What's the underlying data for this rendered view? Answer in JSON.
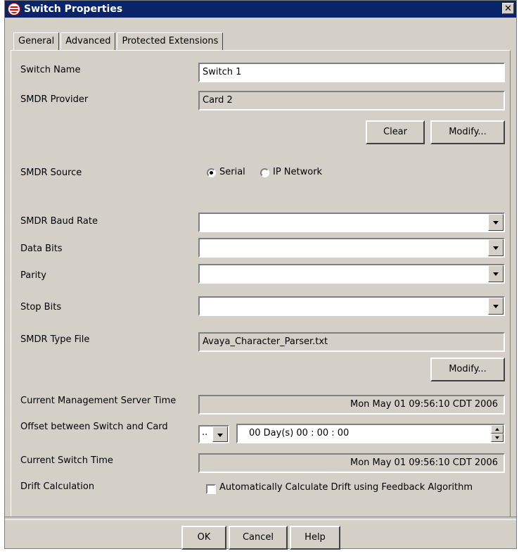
{
  "window": {
    "title": "Switch Properties",
    "close_glyph": "✕"
  },
  "tabs": [
    {
      "label": "General",
      "active": true
    },
    {
      "label": "Advanced",
      "active": false
    },
    {
      "label": "Protected Extensions",
      "active": false
    }
  ],
  "form": {
    "switch_name": {
      "label": "Switch Name",
      "value": "Switch 1"
    },
    "smdr_provider": {
      "label": "SMDR Provider",
      "value": "Card 2"
    },
    "provider_buttons": {
      "clear": "Clear",
      "modify": "Modify..."
    },
    "smdr_source": {
      "label": "SMDR Source",
      "options": [
        "Serial",
        "IP Network"
      ],
      "selected": "Serial"
    },
    "baud_rate": {
      "label": "SMDR Baud Rate",
      "value": ""
    },
    "data_bits": {
      "label": "Data Bits",
      "value": ""
    },
    "parity": {
      "label": "Parity",
      "value": ""
    },
    "stop_bits": {
      "label": "Stop Bits",
      "value": ""
    },
    "type_file": {
      "label": "SMDR Type File",
      "value": "Avaya_Character_Parser.txt",
      "modify": "Modify..."
    },
    "server_time": {
      "label": "Current Management Server Time",
      "value": "Mon May 01 09:56:10 CDT 2006"
    },
    "offset": {
      "label": "Offset between Switch and Card",
      "sign_value": "..",
      "value": "00 Day(s) 00 : 00 : 00"
    },
    "switch_time": {
      "label": "Current Switch Time",
      "value": "Mon May 01 09:56:10 CDT 2006"
    },
    "drift": {
      "label": "Drift Calculation",
      "checkbox_label": "Automatically Calculate Drift using Feedback Algorithm",
      "checked": false
    }
  },
  "footer": {
    "ok": "OK",
    "cancel": "Cancel",
    "help": "Help"
  },
  "icons": {
    "app": "globe-icon",
    "close": "close-icon",
    "dropdown": "chevron-down-icon"
  },
  "colors": {
    "titlebar": "#0a246a",
    "dialog_bg": "#d4d0c8"
  }
}
